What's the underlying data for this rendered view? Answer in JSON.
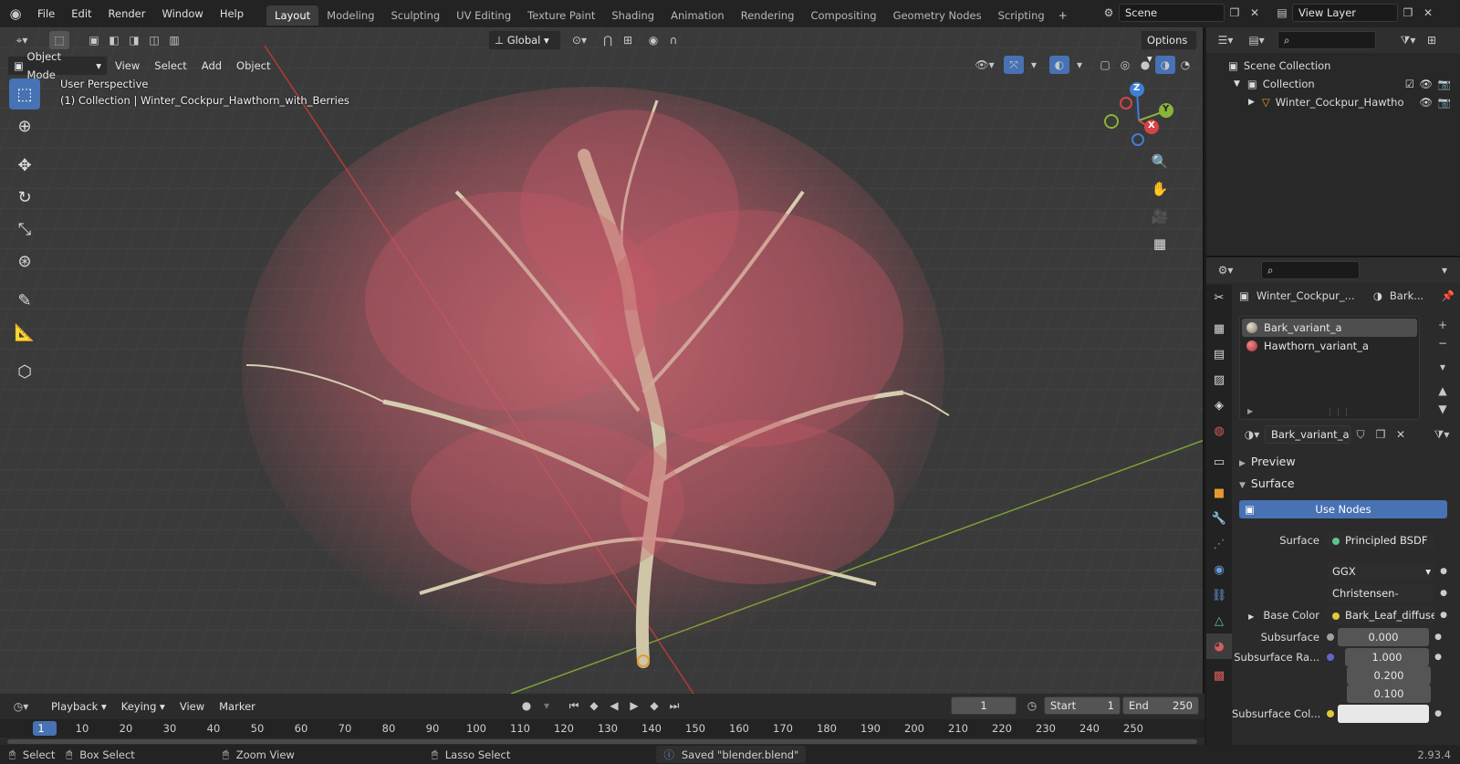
{
  "topbar": {
    "menus": [
      "File",
      "Edit",
      "Render",
      "Window",
      "Help"
    ],
    "workspaces": [
      "Layout",
      "Modeling",
      "Sculpting",
      "UV Editing",
      "Texture Paint",
      "Shading",
      "Animation",
      "Rendering",
      "Compositing",
      "Geometry Nodes",
      "Scripting"
    ],
    "active_workspace": "Layout",
    "scene": "Scene",
    "view_layer": "View Layer"
  },
  "viewport": {
    "transform_orientation": "Global",
    "options_label": "Options",
    "mode": "Object Mode",
    "menus": [
      "View",
      "Select",
      "Add",
      "Object"
    ],
    "overlay_line1": "User Perspective",
    "overlay_line2": "(1) Collection | Winter_Cockpur_Hawthorn_with_Berries",
    "gizmo_axes": {
      "z": "Z",
      "y": "Y",
      "x": "X"
    }
  },
  "timeline": {
    "menus": [
      "Playback",
      "Keying",
      "View",
      "Marker"
    ],
    "current_frame": "1",
    "start_label": "Start",
    "start": "1",
    "end_label": "End",
    "end": "250",
    "ruler": [
      "1",
      "10",
      "20",
      "30",
      "40",
      "50",
      "60",
      "70",
      "80",
      "90",
      "100",
      "110",
      "120",
      "130",
      "140",
      "150",
      "160",
      "170",
      "180",
      "190",
      "200",
      "210",
      "220",
      "230",
      "240",
      "250"
    ]
  },
  "outliner": {
    "scene_collection": "Scene Collection",
    "collection": "Collection",
    "object": "Winter_Cockpur_Hawtho"
  },
  "properties": {
    "object_name": "Winter_Cockpur_...",
    "material_short": "Bark...",
    "slots": [
      "Bark_variant_a",
      "Hawthorn_variant_a"
    ],
    "active_material": "Bark_variant_a",
    "preview_label": "Preview",
    "surface_panel": "Surface",
    "use_nodes": "Use Nodes",
    "rows": {
      "surface_label": "Surface",
      "surface_value": "Principled BSDF",
      "distribution": "GGX",
      "subsurface_method": "Christensen-Burley",
      "base_color_label": "Base Color",
      "base_color_value": "Bark_Leaf_diffuse_...",
      "subsurface_label": "Subsurface",
      "subsurface_value": "0.000",
      "subsurface_radius_label": "Subsurface Ra...",
      "subsurface_radius": [
        "1.000",
        "0.200",
        "0.100"
      ],
      "subsurface_color_label": "Subsurface Col..."
    }
  },
  "statusbar": {
    "select": "Select",
    "box_select": "Box Select",
    "zoom_view": "Zoom View",
    "lasso_select": "Lasso Select",
    "saved": "Saved \"blender.blend\"",
    "version": "2.93.4"
  },
  "colors": {
    "accent": "#4772b3",
    "berry": "#c9525c",
    "x_axis": "#c0392b",
    "y_axis": "#7fa233"
  }
}
